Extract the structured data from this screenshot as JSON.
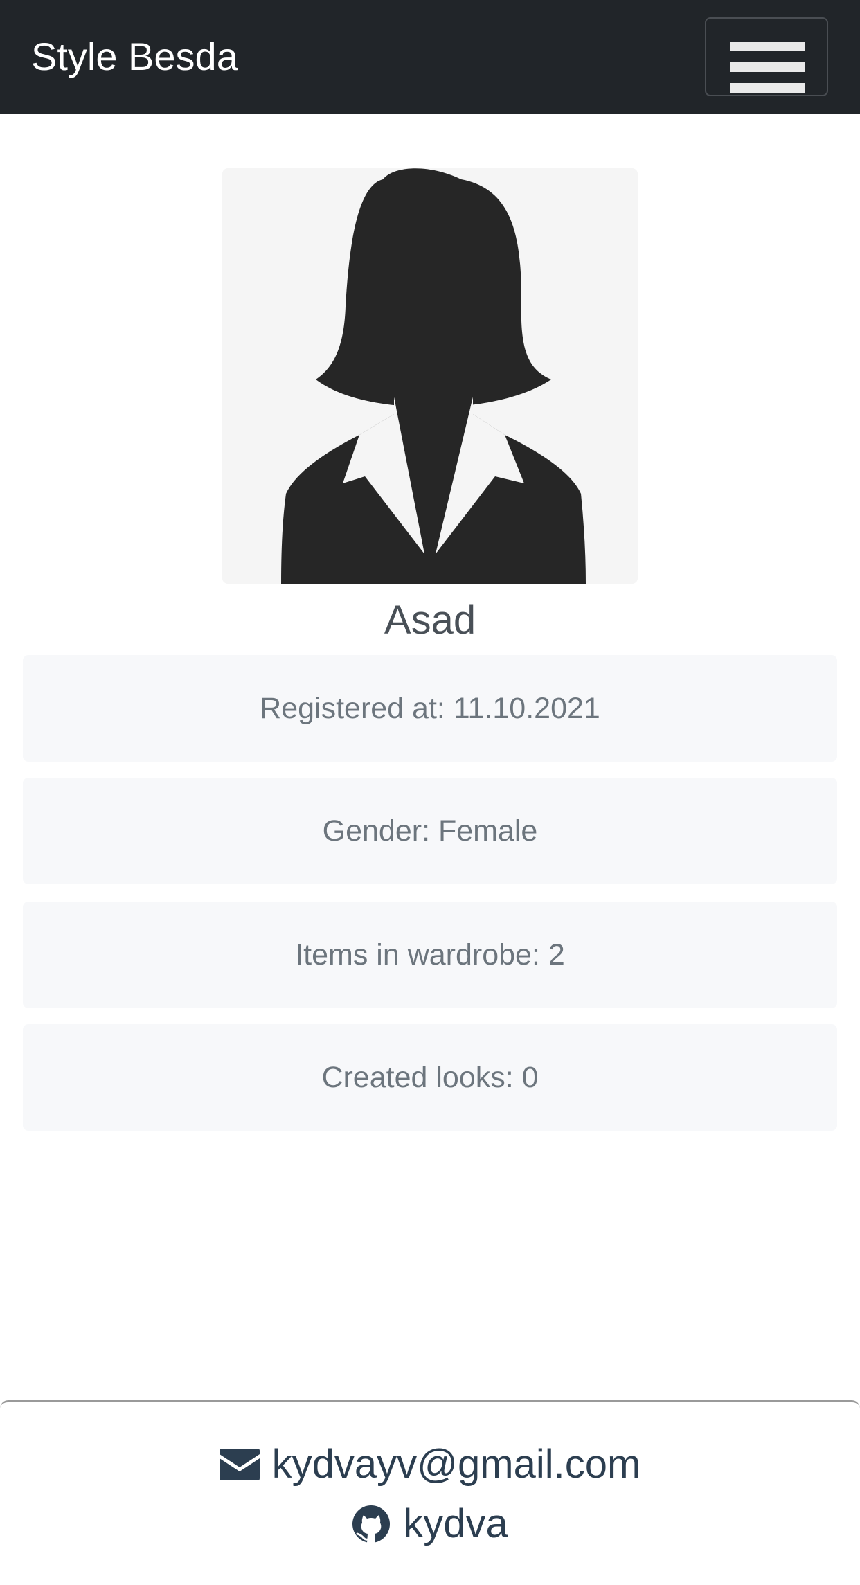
{
  "navbar": {
    "brand": "Style Besda",
    "menu_icon": "hamburger-menu-icon"
  },
  "profile": {
    "avatar_icon": "female-user-silhouette-icon",
    "name": "Asad",
    "registered": "Registered at: 11.10.2021",
    "gender": "Gender: Female",
    "wardrobe_items": "Items in wardrobe: 2",
    "created_looks": "Created looks: 0"
  },
  "footer": {
    "email": "kydvayv@gmail.com",
    "email_icon": "envelope-icon",
    "github": "kydva",
    "github_icon": "github-icon"
  },
  "colors": {
    "navbar_bg": "#212529",
    "card_bg": "#f7f8fa",
    "card_text": "#6c757d",
    "footer_text": "#2c3e50"
  }
}
